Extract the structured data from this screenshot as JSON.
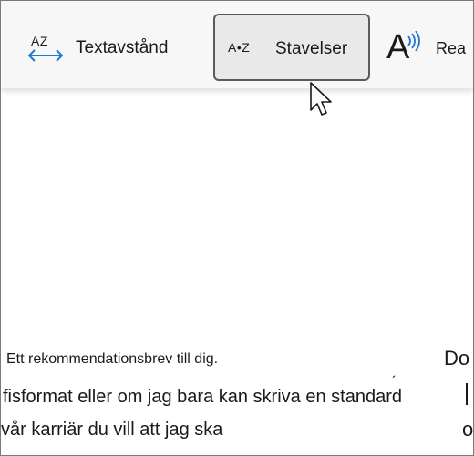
{
  "toolbar": {
    "text_spacing": {
      "icon_text": "AZ",
      "label": "Textavstånd"
    },
    "syllables": {
      "icon_text": "A•Z",
      "label": "Stavelser"
    },
    "read_aloud": {
      "icon_text": "A",
      "label": "Rea"
    }
  },
  "document": {
    "line1": "Ett rekommendationsbrev till dig.",
    "line2": "fisformat eller om jag bara kan skriva en standard",
    "line3": "vår karriär du vill att jag ska",
    "accent_mark": "ˏ",
    "right_fragment": "Do",
    "right_fragment_bottom": "o"
  },
  "colors": {
    "toolbar_bg": "#f7f7f7",
    "active_tool_bg": "#e9e9e9",
    "accent_blue": "#1f7acb"
  }
}
